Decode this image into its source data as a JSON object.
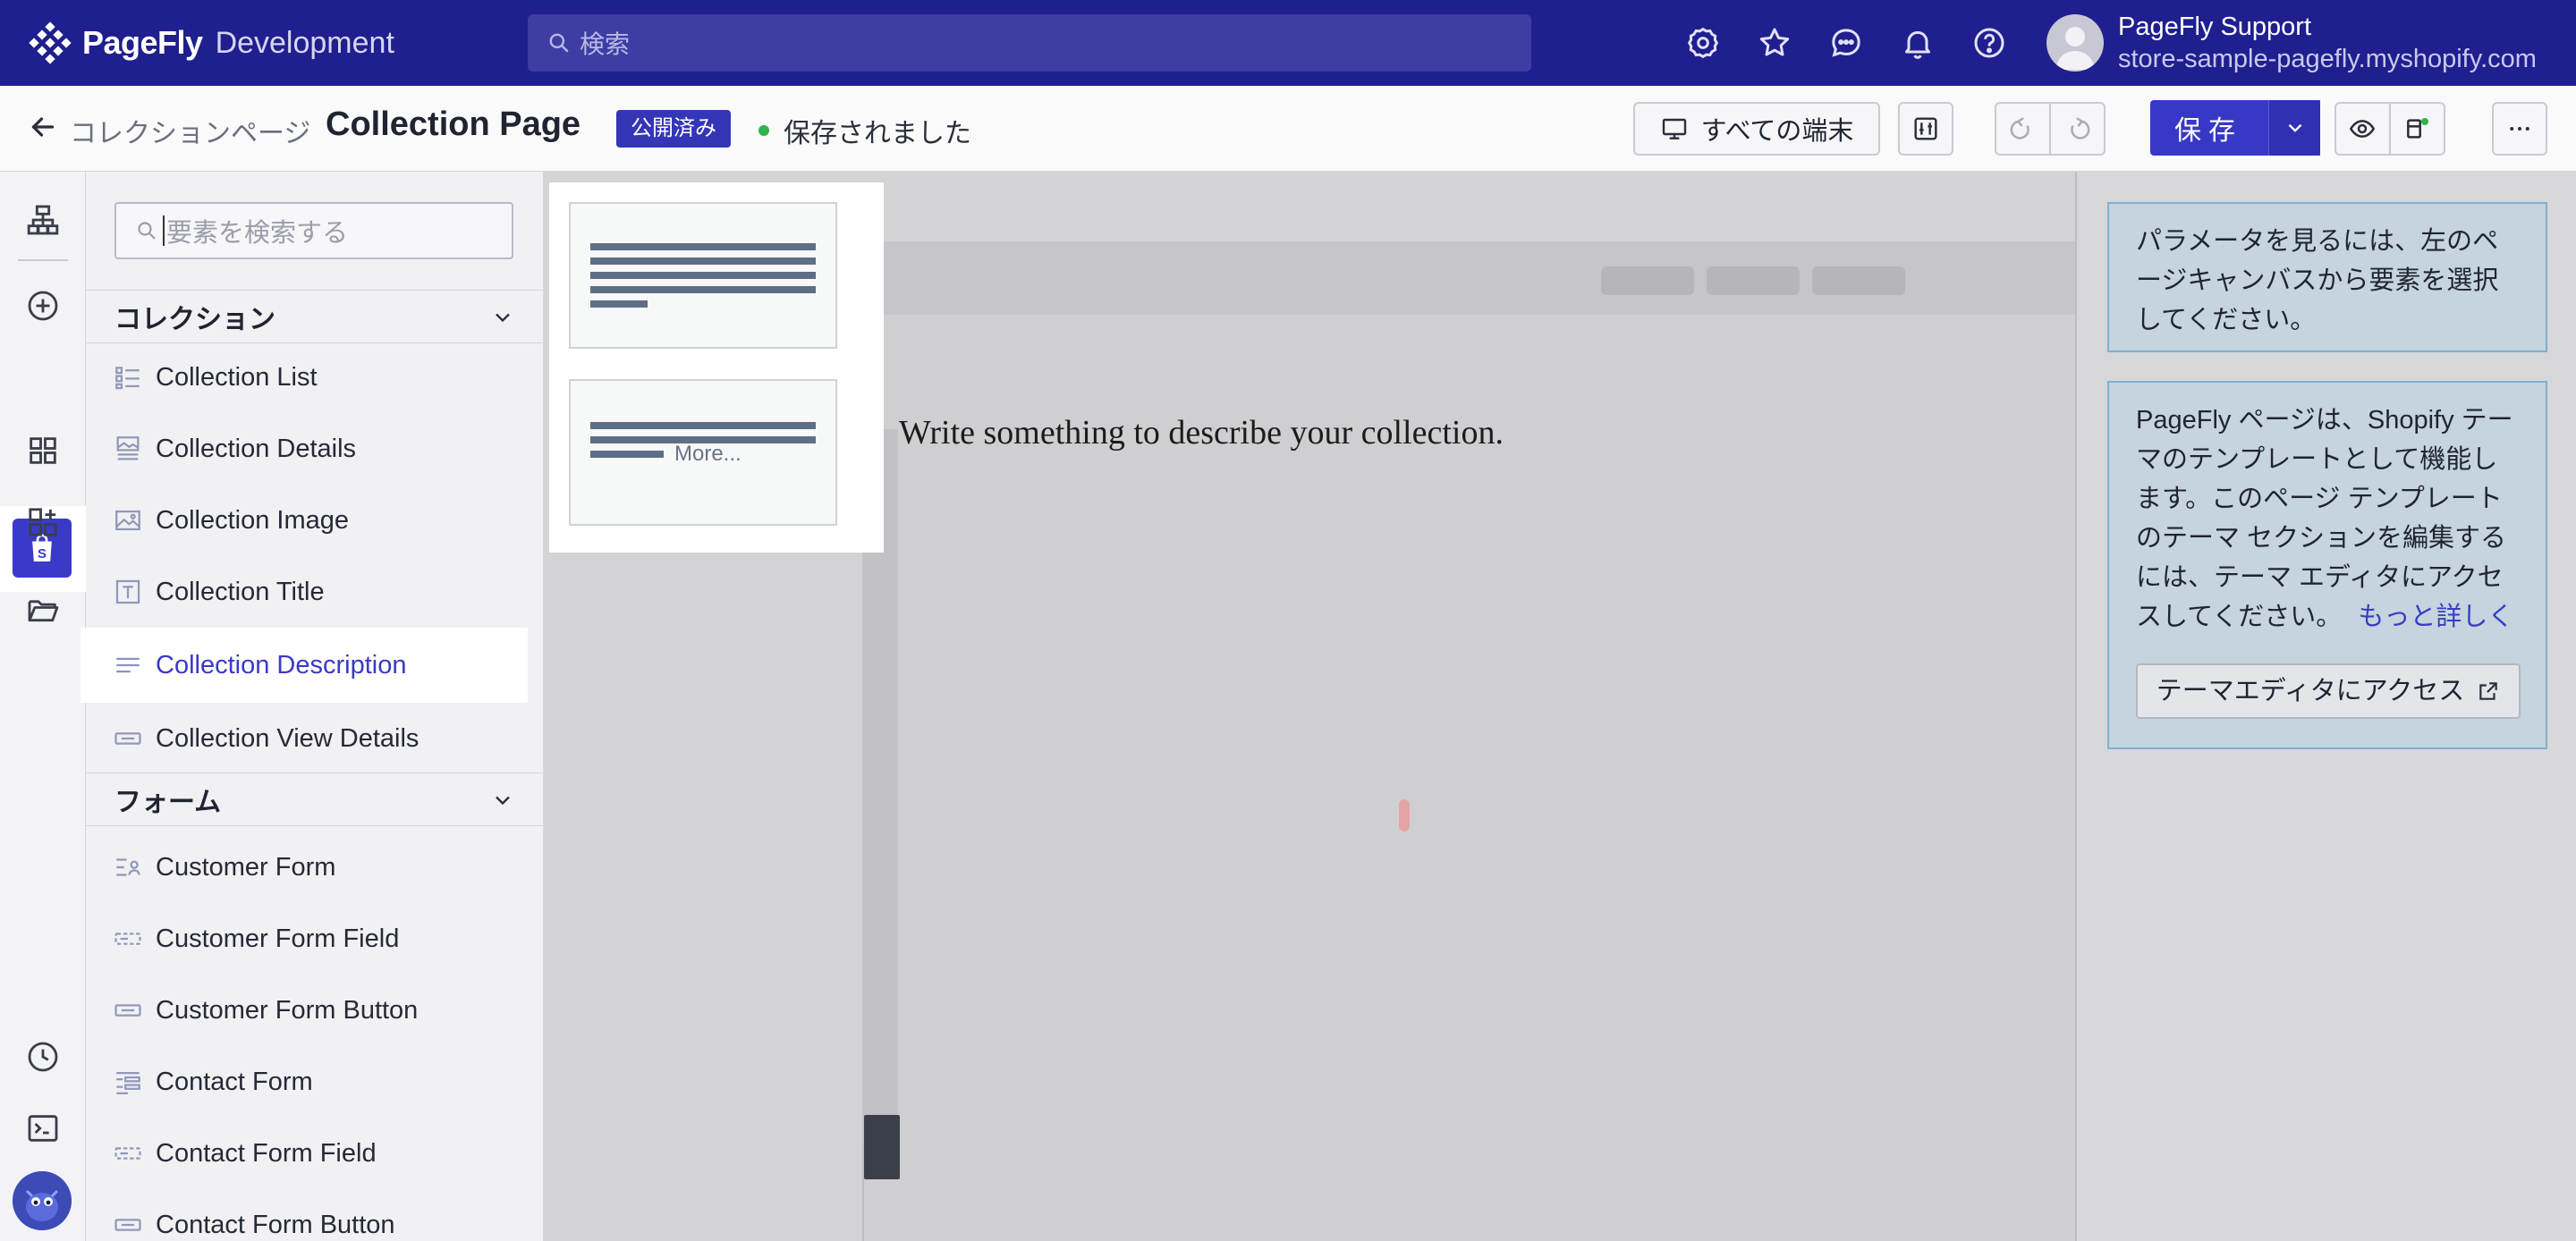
{
  "app": {
    "brand": "PageFly",
    "brand_sub": "Development",
    "search_placeholder": "検索",
    "account_name": "PageFly Support",
    "account_store": "store-sample-pagefly.myshopify.com",
    "top_icons": [
      "settings-gear-icon",
      "star-icon",
      "chat-icon",
      "bell-icon",
      "help-icon"
    ]
  },
  "header": {
    "breadcrumb": "コレクションページ",
    "title": "Collection Page",
    "status_badge": "公開済み",
    "saved_status": "保存されました",
    "device_label": "すべての端末",
    "save_label": "保存"
  },
  "panel": {
    "search_placeholder": "要素を検索する",
    "sections": [
      {
        "title": "コレクション",
        "items": [
          "Collection List",
          "Collection Details",
          "Collection Image",
          "Collection Title",
          "Collection Description",
          "Collection View Details"
        ]
      },
      {
        "title": "フォーム",
        "items": [
          "Customer Form",
          "Customer Form Field",
          "Customer Form Button",
          "Contact Form",
          "Contact Form Field",
          "Contact Form Button"
        ]
      }
    ],
    "active_item": "Collection Description"
  },
  "variants": {
    "more_label": "More..."
  },
  "canvas": {
    "description": "Write something to describe your collection."
  },
  "info": {
    "box1": "パラメータを見るには、左のページキャンバスから要素を選択してください。",
    "box2": "PageFly ページは、Shopify テーマのテンプレートとして機能します。このページ テンプレートのテーマ セクションを編集するには、テーマ エディタにアクセスしてください。",
    "box2_link": "もっと詳しく",
    "theme_button": "テーマエディタにアクセス"
  },
  "colors": {
    "topbar": "#1f1f8f",
    "accent": "#3a3ac8",
    "saved_dot": "#2fb34a"
  }
}
